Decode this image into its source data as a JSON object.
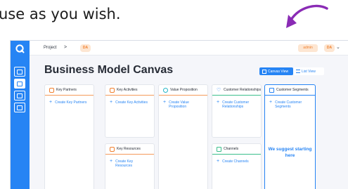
{
  "caption": "use as you wish.",
  "sidebar": {
    "icons": [
      "logo-icon",
      "board-icon",
      "canvas-icon",
      "document-icon",
      "card-icon"
    ]
  },
  "topbar": {
    "breadcrumb_project": "Project",
    "breadcrumb_separator": ">",
    "project_badge": "DA",
    "user_badge": "admin",
    "avatar_initials": "DA",
    "avatar_chevron": "⌄"
  },
  "main": {
    "title": "Business Model Canvas",
    "views": {
      "canvas": "Canvas View",
      "list": "List View"
    }
  },
  "cards": {
    "key_partners": {
      "title": "Key Partners",
      "add": "Create Key Partners"
    },
    "key_activities": {
      "title": "Key Activities",
      "add": "Create Key Activities"
    },
    "value_proposition": {
      "title": "Value Proposition",
      "add": "Create Value Proposition"
    },
    "customer_relationships": {
      "title": "Customer Relationships",
      "add": "Create Customer Relationships"
    },
    "customer_segments": {
      "title": "Customer Segments",
      "add": "Create Customer Segments",
      "suggestion": "We suggest starting here"
    },
    "key_resources": {
      "title": "Key Resources",
      "add": "Create Key Resources"
    },
    "channels": {
      "title": "Channels",
      "add": "Create Channels"
    }
  },
  "colors": {
    "accent": "#2684f4",
    "orange": "#f59a5b",
    "green": "#3bbf8c",
    "annotation_arrow": "#8a2bb5"
  }
}
